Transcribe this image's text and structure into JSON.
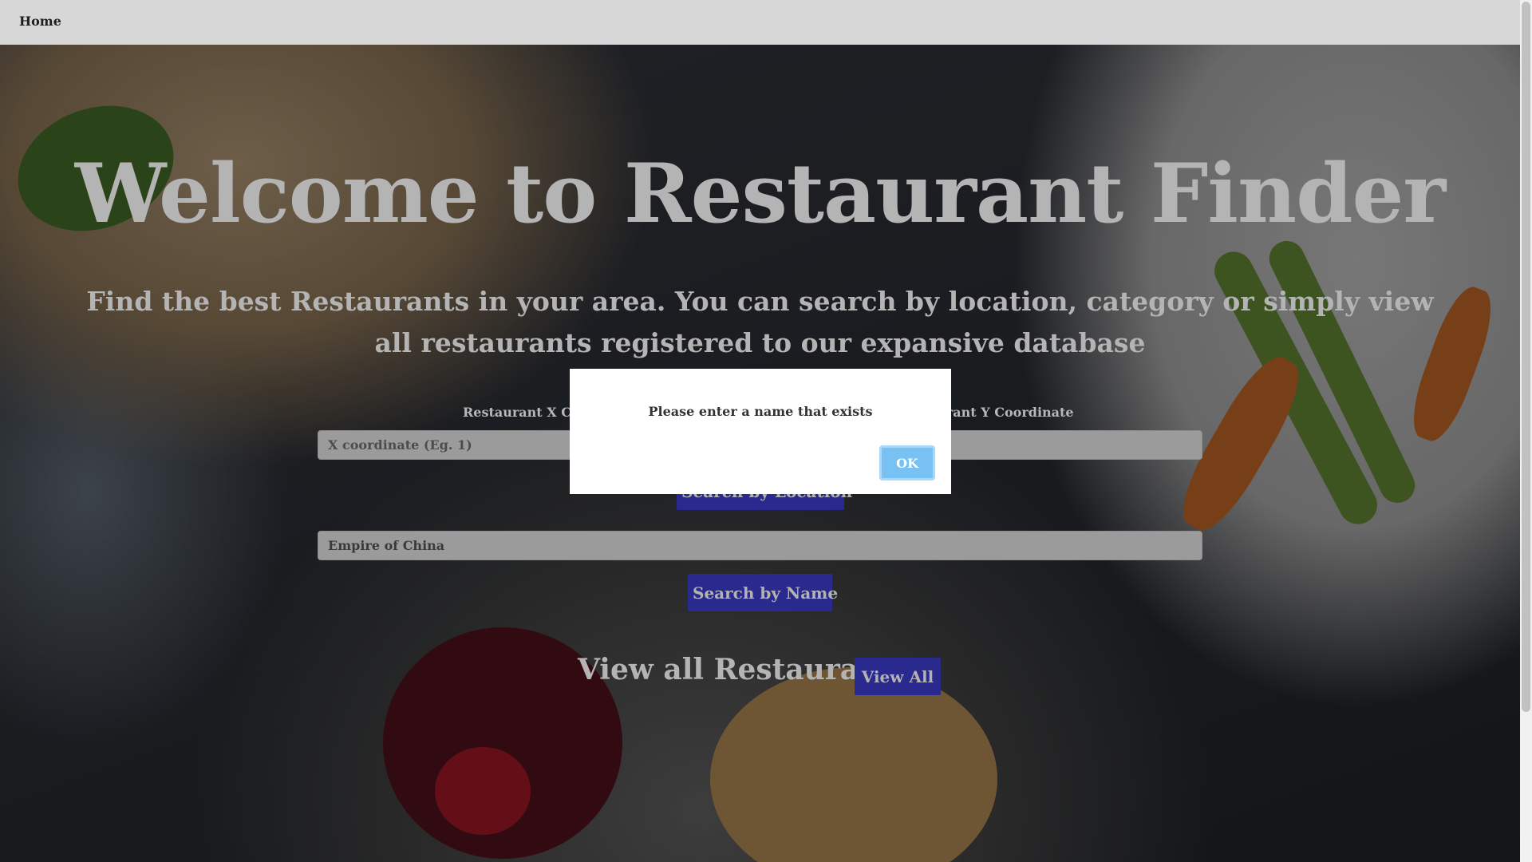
{
  "nav": {
    "home_label": "Home"
  },
  "hero": {
    "title": "Welcome to Restaurant Finder",
    "subtitle": "Find the best Restaurants in your area. You can search by location, category or simply view all restaurants registered to our expansive database"
  },
  "location_search": {
    "x_label": "Restaurant X Coordinate",
    "y_label": "Restaurant Y Coordinate",
    "x_placeholder": "X coordinate (Eg. 1)",
    "y_placeholder": "",
    "button_label": "Search by Location"
  },
  "name_search": {
    "value": "Empire of China",
    "button_label": "Search by Name"
  },
  "view_all": {
    "heading": "View all Restaurants",
    "button_label": "View All"
  },
  "dialog": {
    "message": "Please enter a name that exists",
    "ok_label": "OK"
  },
  "colors": {
    "button_bg": "#2a2a8e",
    "ok_button_bg": "#78c2f3",
    "navbar_bg": "#d7d7d7"
  }
}
